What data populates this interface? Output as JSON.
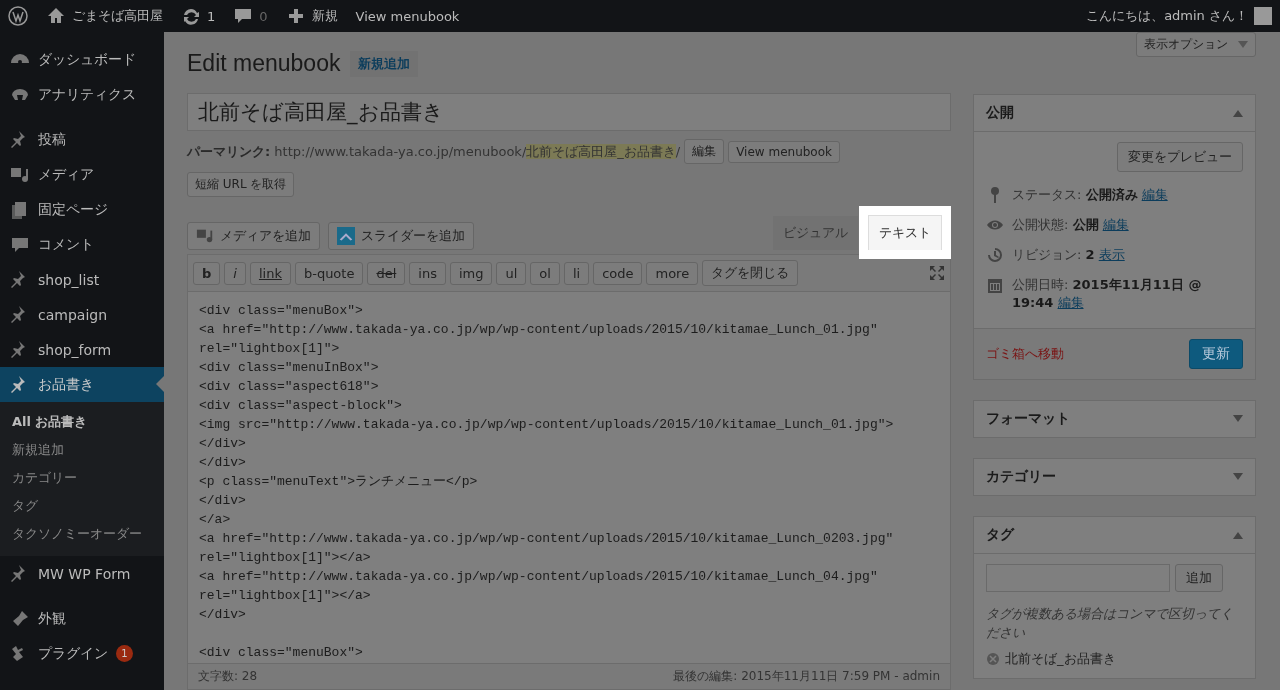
{
  "admin_bar": {
    "site": "ごまそば高田屋",
    "updates": "1",
    "comments": "0",
    "new": "新規",
    "view": "View menubook",
    "greeting": "こんにちは、admin さん！"
  },
  "sidebar": {
    "groups": [
      [
        {
          "label": "ダッシュボード",
          "selected": false
        },
        {
          "label": "アナリティクス",
          "selected": false
        }
      ],
      [
        {
          "label": "投稿",
          "selected": false
        },
        {
          "label": "メディア",
          "selected": false
        },
        {
          "label": "固定ページ",
          "selected": false
        },
        {
          "label": "コメント",
          "selected": false
        },
        {
          "label": "shop_list",
          "selected": false
        },
        {
          "label": "campaign",
          "selected": false
        },
        {
          "label": "shop_form",
          "selected": false
        },
        {
          "label": "お品書き",
          "selected": true,
          "children": [
            {
              "label": "All お品書き",
              "selected": true
            },
            {
              "label": "新規追加",
              "selected": false
            },
            {
              "label": "カテゴリー",
              "selected": false
            },
            {
              "label": "タグ",
              "selected": false
            },
            {
              "label": "タクソノミーオーダー",
              "selected": false
            }
          ]
        },
        {
          "label": "MW WP Form",
          "selected": false
        }
      ],
      [
        {
          "label": "外観",
          "selected": false
        },
        {
          "label": "プラグイン",
          "selected": false,
          "badge": "1"
        }
      ]
    ]
  },
  "screen_options": "表示オプション",
  "heading": {
    "title": "Edit menubook",
    "add_new": "新規追加"
  },
  "post_title": "北前そば高田屋_お品書き",
  "permalink": {
    "label": "パーマリンク:",
    "url": "http://www.takada-ya.co.jp/menubook/",
    "slug": "北前そば高田屋_お品書き",
    "tail": "/",
    "buttons": [
      "編集",
      "View menubook",
      "短縮 URL を取得"
    ]
  },
  "media_buttons": [
    "メディアを追加",
    "スライダーを追加"
  ],
  "editor_tabs": [
    {
      "label": "ビジュアル",
      "selected": false
    },
    {
      "label": "テキスト",
      "selected": true
    }
  ],
  "quicktags": [
    {
      "label": "b",
      "kind": "bold"
    },
    {
      "label": "i",
      "kind": "italic"
    },
    {
      "label": "link",
      "kind": "underline"
    },
    {
      "label": "b-quote",
      "kind": "plain"
    },
    {
      "label": "del",
      "kind": "strike"
    },
    {
      "label": "ins",
      "kind": "plain"
    },
    {
      "label": "img",
      "kind": "plain"
    },
    {
      "label": "ul",
      "kind": "plain"
    },
    {
      "label": "ol",
      "kind": "plain"
    },
    {
      "label": "li",
      "kind": "plain"
    },
    {
      "label": "code",
      "kind": "plain"
    },
    {
      "label": "more",
      "kind": "plain"
    },
    {
      "label": "タグを閉じる",
      "kind": "plain"
    }
  ],
  "code_blocks": [
    [
      "<div class=\"menuBox\">",
      "<a href=\"http://www.takada-ya.co.jp/wp/wp-content/uploads/2015/10/kitamae_Lunch_01.jpg\"",
      "rel=\"lightbox[1]\">",
      "<div class=\"menuInBox\">",
      "<div class=\"aspect618\">",
      "<div class=\"aspect-block\">",
      "<img src=\"http://www.takada-ya.co.jp/wp/wp-content/uploads/2015/10/kitamae_Lunch_01.jpg\">",
      "</div>",
      "</div>",
      "<p class=\"menuText\">ランチメニュー</p>",
      "</div>",
      "</a>",
      "<a href=\"http://www.takada-ya.co.jp/wp/wp-content/uploads/2015/10/kitamae_Lunch_0203.jpg\"",
      "rel=\"lightbox[1]\"></a>",
      "<a href=\"http://www.takada-ya.co.jp/wp/wp-content/uploads/2015/10/kitamae_Lunch_04.jpg\"",
      "rel=\"lightbox[1]\"></a>",
      "</div>"
    ],
    [
      "<div class=\"menuBox\">"
    ]
  ],
  "word_count": "文字数: 28",
  "last_edit": "最後の編集: 2015年11月11日 7:59 PM - admin",
  "publish": {
    "title": "公開",
    "expanded": true,
    "preview": "変更をプレビュー",
    "rows": [
      {
        "label": "ステータス:",
        "value": "公開済み",
        "link": "編集"
      },
      {
        "label": "公開状態:",
        "value": "公開",
        "link": "編集"
      },
      {
        "label": "リビジョン:",
        "value": "2",
        "link": "表示"
      },
      {
        "label": "公開日時:",
        "value": "2015年11月11日 @ 19:44",
        "link": "編集"
      }
    ],
    "trash": "ゴミ箱へ移動",
    "update": "更新"
  },
  "boxes": [
    {
      "title": "フォーマット",
      "expanded": false
    },
    {
      "title": "カテゴリー",
      "expanded": false
    }
  ],
  "tags": {
    "title": "タグ",
    "expanded": true,
    "add": "追加",
    "hint": "タグが複数ある場合はコンマで区切ってください",
    "items": [
      "北前そば_お品書き"
    ]
  }
}
